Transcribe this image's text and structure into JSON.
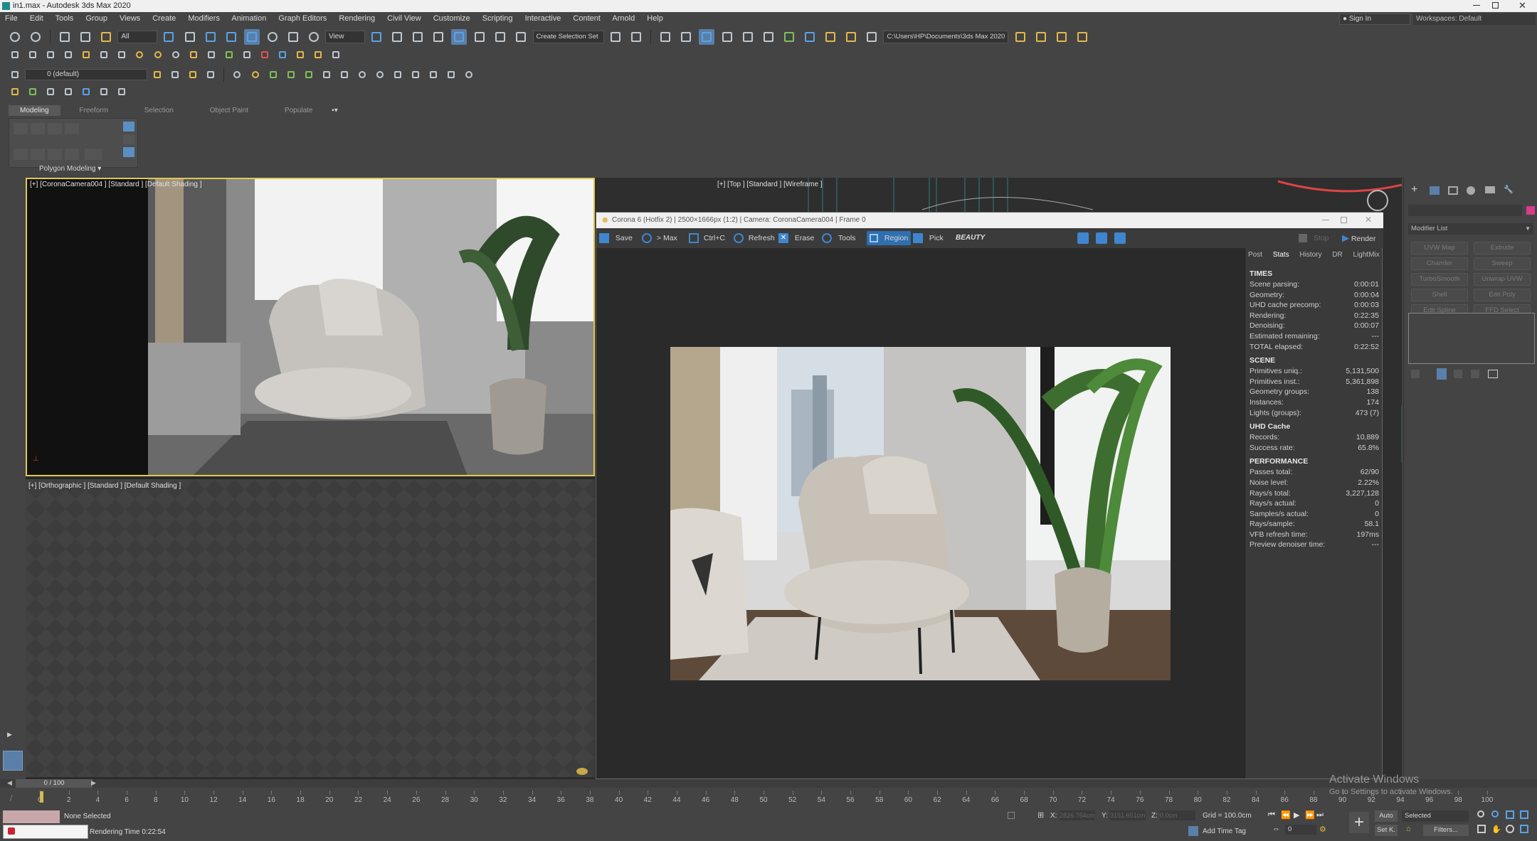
{
  "window": {
    "title": "in1.max - Autodesk 3ds Max 2020"
  },
  "menubar": [
    "File",
    "Edit",
    "Tools",
    "Group",
    "Views",
    "Create",
    "Modifiers",
    "Animation",
    "Graph Editors",
    "Rendering",
    "Civil View",
    "Customize",
    "Scripting",
    "Interactive",
    "Content",
    "Arnold",
    "Help"
  ],
  "account": {
    "sign_in": "Sign In",
    "workspaces_label": "Workspaces:",
    "workspace": "Default"
  },
  "main_toolbar": {
    "selection_filter": "All",
    "ref_coord": "View",
    "selection_set": "Create Selection Set",
    "project_path": "C:\\Users\\HP\\Documents\\3ds Max 2020"
  },
  "layer_toolbar": {
    "layer": "0 (default)"
  },
  "ribbon": {
    "tabs": [
      "Modeling",
      "Freeform",
      "Selection",
      "Object Paint",
      "Populate"
    ],
    "panel_label": "Polygon Modeling"
  },
  "viewports": {
    "camera_label": "[+] [CoronaCamera004 ] [Standard ] [Default Shading ]",
    "top_label": "[+] [Top ] [Standard ] [Wireframe ]",
    "ortho_label": "[+] [Orthographic ] [Standard ] [Default Shading ]"
  },
  "vfb": {
    "title": "Corona 6 (Hotfix 2) | 2500×1666px (1:2) | Camera: CoronaCamera004 | Frame 0",
    "toolbar": {
      "save": "Save",
      "to_max": "> Max",
      "copy": "Ctrl+C",
      "refresh": "Refresh",
      "erase": "Erase",
      "tools": "Tools",
      "region": "Region",
      "pick": "Pick",
      "channel": "BEAUTY",
      "stop": "Stop",
      "render": "Render"
    },
    "tabs": [
      "Post",
      "Stats",
      "History",
      "DR",
      "LightMix"
    ],
    "active_tab": "Stats",
    "stats": [
      {
        "section": "TIMES",
        "rows": [
          [
            "Scene parsing:",
            "0:00:01"
          ],
          [
            "Geometry:",
            "0:00:04"
          ],
          [
            "UHD cache precomp:",
            "0:00:03"
          ],
          [
            "Rendering:",
            "0:22:35"
          ],
          [
            "Denoising:",
            "0:00:07"
          ],
          [
            "Estimated remaining:",
            "---"
          ],
          [
            "TOTAL elapsed:",
            "0:22:52"
          ]
        ]
      },
      {
        "section": "SCENE",
        "rows": [
          [
            "Primitives uniq.:",
            "5,131,500"
          ],
          [
            "Primitives inst.:",
            "5,361,898"
          ],
          [
            "Geometry groups:",
            "138"
          ],
          [
            "Instances:",
            "174"
          ],
          [
            "Lights (groups):",
            "473 (7)"
          ]
        ]
      },
      {
        "section": "UHD Cache",
        "rows": [
          [
            "Records:",
            "10,889"
          ],
          [
            "Success rate:",
            "65.8%"
          ]
        ]
      },
      {
        "section": "PERFORMANCE",
        "rows": [
          [
            "Passes total:",
            "62/90"
          ],
          [
            "Noise level:",
            "2.22%"
          ],
          [
            "Rays/s total:",
            "3,227,128"
          ],
          [
            "Rays/s actual:",
            "0"
          ],
          [
            "Samples/s actual:",
            "0"
          ],
          [
            "Rays/sample:",
            "58.1"
          ],
          [
            "VFB refresh time:",
            "197ms"
          ],
          [
            "Preview denoiser time:",
            "---"
          ]
        ]
      }
    ]
  },
  "command_panel": {
    "modifier_list": "Modifier List",
    "buttons": [
      "UVW Map",
      "Extrude",
      "Chamfer",
      "Sweep",
      "TurboSmooth",
      "Unwrap UVW",
      "Shell",
      "Edit Poly",
      "Edit Spline",
      "FFD Select"
    ]
  },
  "timeline": {
    "frame": "0 / 100",
    "ticks": [
      "0",
      "2",
      "4",
      "6",
      "8",
      "10",
      "12",
      "14",
      "16",
      "18",
      "20",
      "22",
      "24",
      "26",
      "28",
      "30",
      "32",
      "34",
      "36",
      "38",
      "40",
      "42",
      "44",
      "46",
      "48",
      "50",
      "52",
      "54",
      "56",
      "58",
      "60",
      "62",
      "64",
      "66",
      "68",
      "70",
      "72",
      "74",
      "76",
      "78",
      "80",
      "82",
      "84",
      "86",
      "88",
      "90",
      "92",
      "94",
      "96",
      "98",
      "100"
    ]
  },
  "status": {
    "selection": "None Selected",
    "render_time": "Rendering Time  0:22:54",
    "x_label": "X:",
    "x_value": "2826.764cm",
    "y_label": "Y:",
    "y_value": "3151.651cm",
    "z_label": "Z:",
    "z_value": "0.0cm",
    "grid": "Grid = 100.0cm",
    "add_time_tag": "Add Time Tag",
    "auto": "Auto",
    "set_key": "Set K.",
    "key_filter": "Selected",
    "filters": "Filters...",
    "frame_spinner": "0"
  },
  "watermark": {
    "line1": "Activate Windows",
    "line2": "Go to Settings to activate Windows."
  }
}
